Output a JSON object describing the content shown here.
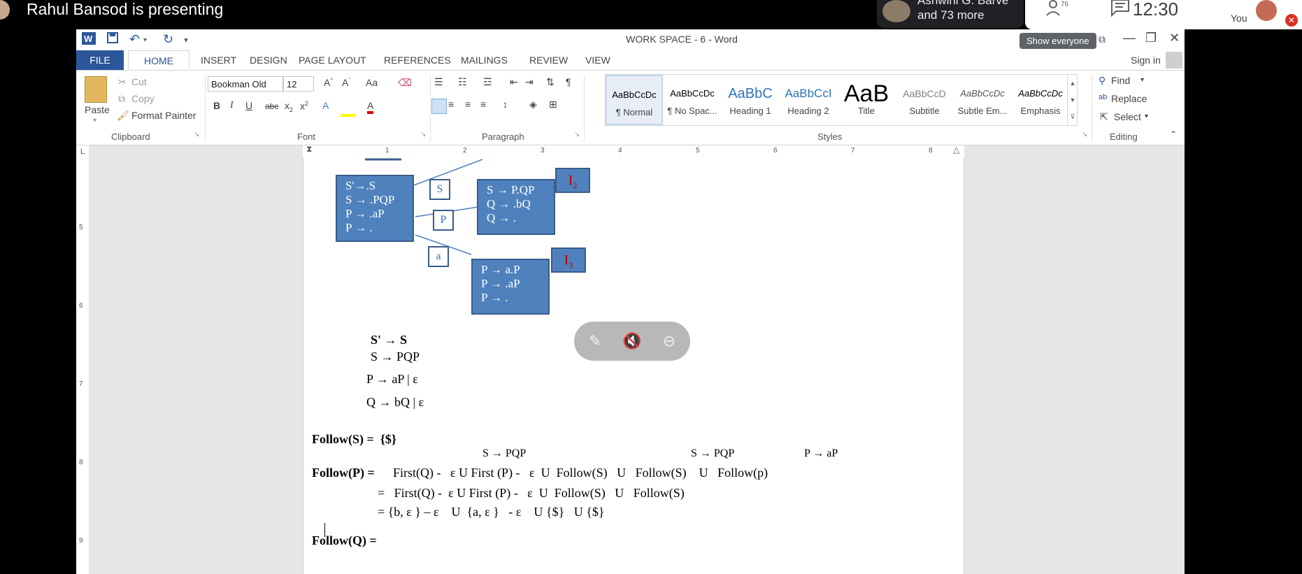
{
  "meet": {
    "presenter_text": "Rahul Bansod is presenting",
    "participants_line1": "Ashwini G. Barve",
    "participants_line2": "and 73 more",
    "people_count": "76",
    "clock": "12:30",
    "you_label": "You",
    "show_everyone": "Show everyone"
  },
  "word": {
    "title": "WORK SPACE - 6 - Word",
    "tabs": [
      "FILE",
      "HOME",
      "INSERT",
      "DESIGN",
      "PAGE LAYOUT",
      "REFERENCES",
      "MAILINGS",
      "REVIEW",
      "VIEW"
    ],
    "signin": "Sign in",
    "clipboard": {
      "paste": "Paste",
      "cut": "Cut",
      "copy": "Copy",
      "format_painter": "Format Painter",
      "label": "Clipboard"
    },
    "font": {
      "name": "Bookman Old",
      "size": "12",
      "label": "Font",
      "case": "Aa"
    },
    "paragraph_label": "Paragraph",
    "styles": {
      "label": "Styles",
      "items": [
        {
          "sample": "AaBbCcDc",
          "name": "¶ Normal"
        },
        {
          "sample": "AaBbCcDc",
          "name": "¶ No Spac..."
        },
        {
          "sample": "AaBbC",
          "name": "Heading 1"
        },
        {
          "sample": "AaBbCcI",
          "name": "Heading 2"
        },
        {
          "sample": "AaB",
          "name": "Title"
        },
        {
          "sample": "AaBbCcD",
          "name": "Subtitle"
        },
        {
          "sample": "AaBbCcDc",
          "name": "Subtle Em..."
        },
        {
          "sample": "AaBbCcDc",
          "name": "Emphasis"
        }
      ]
    },
    "editing": {
      "find": "Find",
      "replace": "Replace",
      "select": "Select",
      "label": "Editing"
    },
    "ruler_numbers": [
      "1",
      "2",
      "3",
      "4",
      "5",
      "6",
      "7",
      "8"
    ],
    "vruler_numbers": [
      "5",
      "6",
      "7",
      "8",
      "9"
    ]
  },
  "doc": {
    "box0": [
      "S'→.S",
      "S → .PQP",
      "P → .aP",
      "P → ."
    ],
    "box_s_label": "S",
    "box_p_label": "P",
    "box_a_label": "a",
    "box2": [
      "S → P.QP",
      "Q → .bQ",
      "Q → ."
    ],
    "box3": [
      "P → a.P",
      "P → .aP",
      "P → ."
    ],
    "i2": "I2",
    "i3": "I3",
    "grammar": [
      "S' → S",
      "S → PQP",
      "P → aP | ε",
      "Q → bQ | ε"
    ],
    "follow_s": "Follow(S) =  {$}",
    "hint1": "S → PQP",
    "hint2": "S → PQP",
    "hint3": "P → aP",
    "follow_p_label": "Follow(P) =",
    "follow_p_line1": "First(Q) -   ε U First (P) -   ε  U  Follow(S)   U   Follow(S)    U   Follow(p)",
    "follow_p_line2": "=   First(Q) -  ε U First (P) -   ε  U  Follow(S)   U   Follow(S)",
    "follow_p_line3": "= {b, ε } – ε    U  {a, ε }   - ε    U {$}   U {$}",
    "follow_q": "Follow(Q) ="
  }
}
